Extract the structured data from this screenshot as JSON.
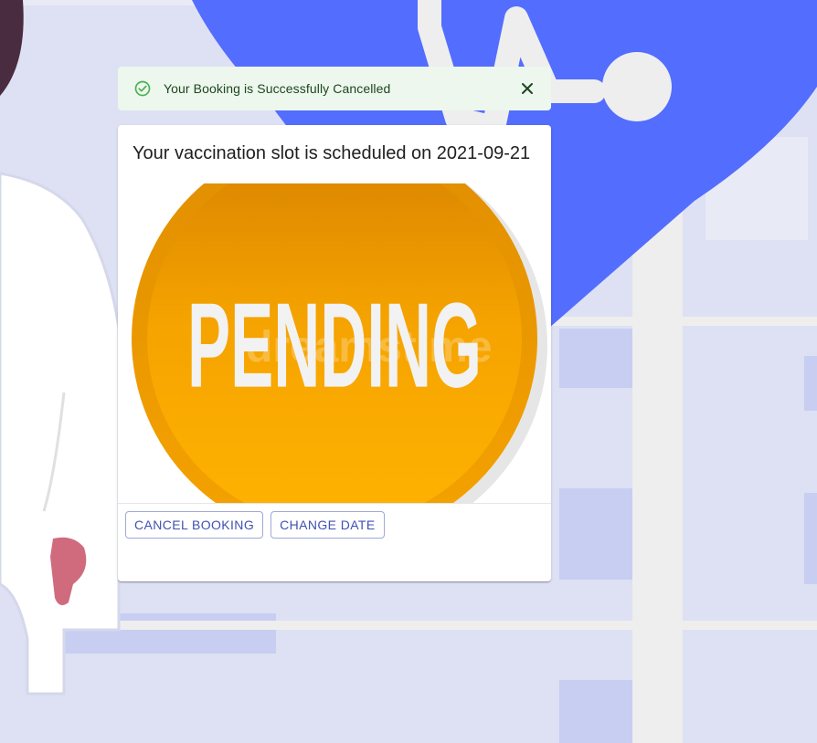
{
  "alert": {
    "message": "Your Booking is Successfully Cancelled",
    "severity_color": "#4caf50",
    "background_color": "#edf7ed",
    "icon": "check-circle-icon",
    "close_icon": "close-icon"
  },
  "card": {
    "title": "Your vaccination slot is scheduled on 2021-09-21",
    "image": {
      "text": "PENDING",
      "watermark": "dreamstime",
      "color": "#f7a800"
    },
    "actions": {
      "cancel_label": "CANCEL BOOKING",
      "change_label": "CHANGE DATE"
    }
  },
  "theme": {
    "accent": "#3f51b5",
    "background_blue": "#536dfe"
  }
}
